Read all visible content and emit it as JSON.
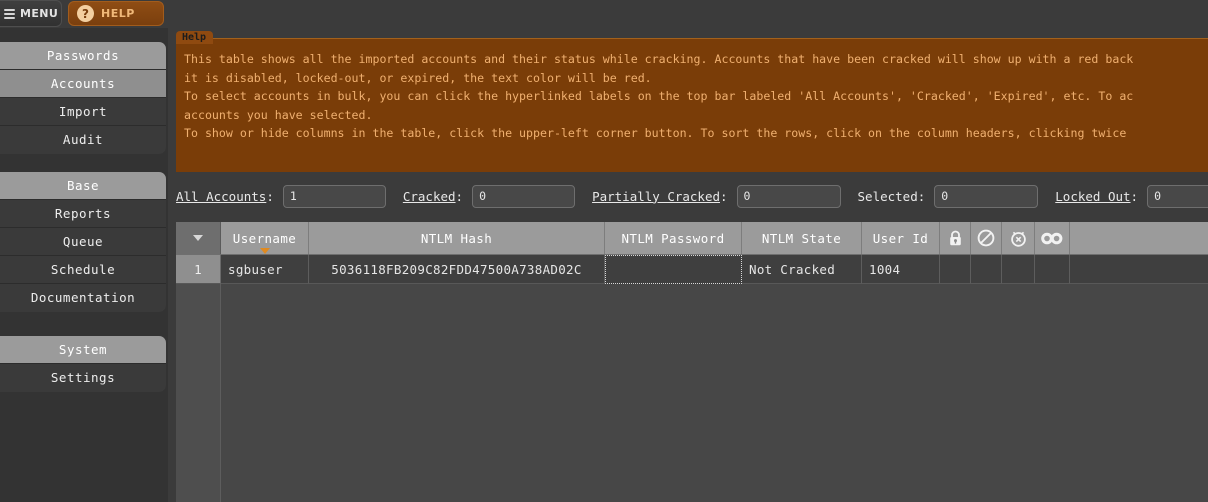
{
  "topbar": {
    "menu_label": "MENU",
    "menu_icon": "hamburger-icon",
    "help_label": "HELP",
    "help_icon": "question-mark-circle-icon",
    "help_icon_glyph": "?"
  },
  "sidebar": {
    "groups": [
      {
        "items": [
          {
            "label": "Passwords",
            "state": "section-head"
          },
          {
            "label": "Accounts",
            "state": "active"
          },
          {
            "label": "Import",
            "state": "normal"
          },
          {
            "label": "Audit",
            "state": "normal"
          }
        ]
      },
      {
        "items": [
          {
            "label": "Base",
            "state": "section-head"
          },
          {
            "label": "Reports",
            "state": "normal"
          },
          {
            "label": "Queue",
            "state": "normal"
          },
          {
            "label": "Schedule",
            "state": "normal"
          },
          {
            "label": "Documentation",
            "state": "normal"
          }
        ]
      },
      {
        "items": [
          {
            "label": "System",
            "state": "section-head"
          },
          {
            "label": "Settings",
            "state": "normal"
          }
        ]
      }
    ]
  },
  "help_panel": {
    "tab_label": "Help",
    "line1": "This table shows all the imported accounts and their status while cracking. Accounts that have been cracked will show up with a red back",
    "line2": "it is disabled, locked-out, or expired, the text color will be red.",
    "line3": "To select accounts in bulk, you can click the hyperlinked labels on the top bar labeled 'All Accounts', 'Cracked', 'Expired', etc. To ac",
    "line4": "accounts you have selected.",
    "line5": "To show or hide columns in the table, click the upper-left corner button. To sort the rows, click on the column headers, clicking twice"
  },
  "filters": [
    {
      "label": "All Accounts",
      "link": true,
      "value": "1",
      "name": "all-accounts"
    },
    {
      "label": "Cracked",
      "link": true,
      "value": "0",
      "name": "cracked"
    },
    {
      "label": "Partially Cracked",
      "link": true,
      "value": "0",
      "name": "partially-cracked"
    },
    {
      "label": "Selected",
      "link": false,
      "value": "0",
      "name": "selected"
    },
    {
      "label": "Locked Out",
      "link": true,
      "value": "0",
      "name": "locked-out"
    }
  ],
  "table": {
    "corner_icon": "chevron-down-icon",
    "columns": [
      {
        "label": "Username",
        "icon": null,
        "sorted": true
      },
      {
        "label": "NTLM Hash",
        "icon": null,
        "sorted": false
      },
      {
        "label": "NTLM Password",
        "icon": null,
        "sorted": false
      },
      {
        "label": "NTLM State",
        "icon": null,
        "sorted": false
      },
      {
        "label": "User Id",
        "icon": null,
        "sorted": false
      },
      {
        "label": "",
        "icon": "lock-icon",
        "sorted": false
      },
      {
        "label": "",
        "icon": "disabled-icon",
        "sorted": false
      },
      {
        "label": "",
        "icon": "expired-clock-icon",
        "sorted": false
      },
      {
        "label": "",
        "icon": "infinity-icon",
        "sorted": false
      }
    ],
    "rows": [
      {
        "num": "1",
        "username": "sgbuser",
        "ntlm_hash": "5036118FB209C82FDD47500A738AD02C",
        "ntlm_password": "",
        "ntlm_state": "Not Cracked",
        "user_id": "1004",
        "lock": "",
        "disabled": "",
        "expired": "",
        "never_expires": ""
      }
    ]
  },
  "colors": {
    "accent_orange": "#e08a20",
    "help_bg": "#7a3d08",
    "help_text": "#f0b070",
    "app_bg": "#3b3b3b",
    "header_gray": "#9b9b9b"
  }
}
